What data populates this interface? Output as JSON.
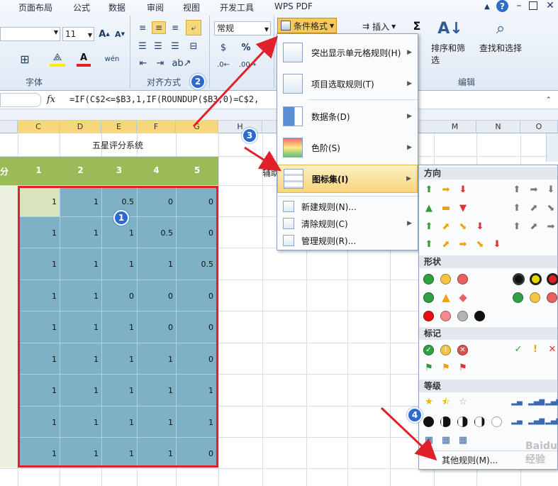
{
  "ribbon_tabs": [
    "页面布局",
    "公式",
    "数据",
    "审阅",
    "视图",
    "开发工具",
    "WPS PDF"
  ],
  "font_size": "11",
  "number_format": "常规",
  "group_labels": {
    "font": "字体",
    "alignment": "对齐方式",
    "editing": "编辑"
  },
  "buttons": {
    "cond_format": "条件格式",
    "insert": "插入",
    "sort_filter": "排序和筛选",
    "find_select": "查找和选择"
  },
  "formula": {
    "fx": "fx",
    "text": "=IF(C$2<=$B3,1,IF(ROUNDUP($B3,0)=C$2,"
  },
  "columns": [
    "C",
    "D",
    "E",
    "F",
    "G",
    "H",
    "M",
    "N",
    "O"
  ],
  "sheet": {
    "title": "五星评分系统",
    "header_partial": "分",
    "header_nums": [
      "1",
      "2",
      "3",
      "4",
      "5"
    ],
    "helper_partial": "辅助",
    "rows": [
      [
        "1",
        "1",
        "0.5",
        "0",
        "0"
      ],
      [
        "1",
        "1",
        "1",
        "0.5",
        "0"
      ],
      [
        "1",
        "1",
        "1",
        "1",
        "0.5"
      ],
      [
        "1",
        "1",
        "0",
        "0",
        "0"
      ],
      [
        "1",
        "1",
        "1",
        "0",
        "0"
      ],
      [
        "1",
        "1",
        "1",
        "1",
        "0"
      ],
      [
        "1",
        "1",
        "1",
        "1",
        "1"
      ],
      [
        "1",
        "1",
        "1",
        "1",
        "1"
      ],
      [
        "1",
        "1",
        "1",
        "1",
        "0"
      ]
    ]
  },
  "menu": {
    "items": [
      {
        "label": "突出显示单元格规则(H)"
      },
      {
        "label": "项目选取规则(T)"
      },
      {
        "label": "数据条(D)"
      },
      {
        "label": "色阶(S)"
      },
      {
        "label": "图标集(I)"
      },
      {
        "label": "新建规则(N)..."
      },
      {
        "label": "清除规则(C)"
      },
      {
        "label": "管理规则(R)..."
      }
    ]
  },
  "submenu": {
    "sections": [
      "方向",
      "形状",
      "标记",
      "等级"
    ],
    "other_rules": "其他规则(M)..."
  },
  "badges": [
    "1",
    "2",
    "3",
    "4"
  ],
  "watermark": "Baidu 经验",
  "colors": {
    "selection_fill": "#7fb1c4",
    "header_green": "#9bbb59",
    "annotation_red": "#e0202a",
    "badge_blue": "#2b6ad0"
  }
}
